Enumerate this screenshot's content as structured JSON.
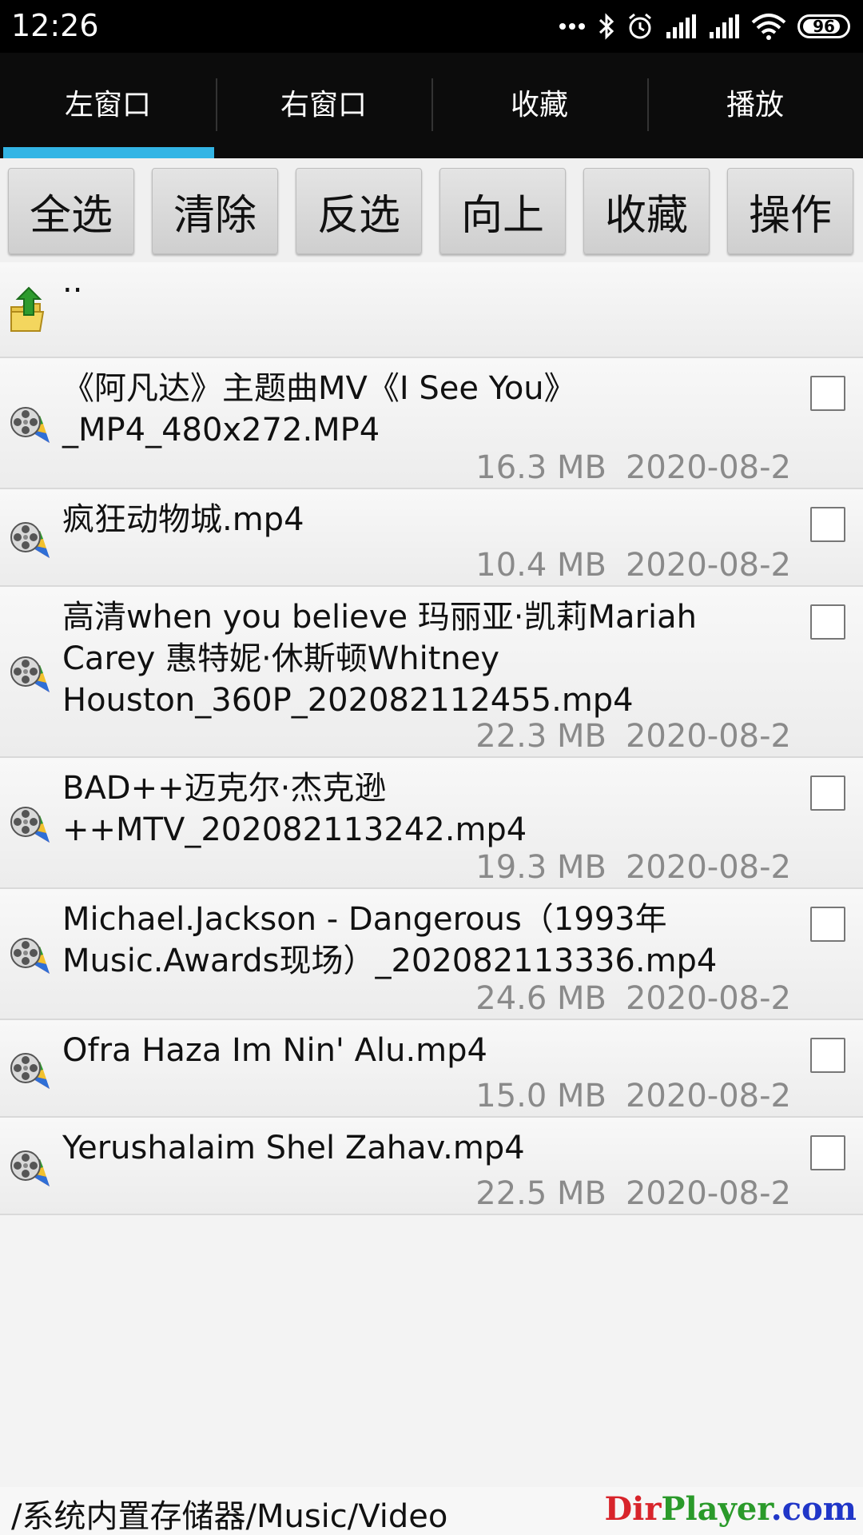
{
  "status_bar": {
    "time": "12:26",
    "icons": [
      "more-dots-icon",
      "bluetooth-icon",
      "alarm-icon",
      "signal-icon",
      "signal-icon",
      "wifi-icon"
    ],
    "battery": "96"
  },
  "tabs": [
    {
      "label": "左窗口",
      "active": true
    },
    {
      "label": "右窗口",
      "active": false
    },
    {
      "label": "收藏",
      "active": false
    },
    {
      "label": "播放",
      "active": false
    }
  ],
  "toolbar": {
    "select_all": "全选",
    "clear": "清除",
    "invert": "反选",
    "up": "向上",
    "favorite": "收藏",
    "operate": "操作"
  },
  "parent_dir": {
    "label": ".."
  },
  "files": [
    {
      "name": "《阿凡达》主题曲MV《I See You》_MP4_480x272.MP4",
      "size": "16.3 MB",
      "date": "2020-08-2"
    },
    {
      "name": "疯狂动物城.mp4",
      "size": "10.4 MB",
      "date": "2020-08-2"
    },
    {
      "name": "高清when you believe 玛丽亚·凯莉Mariah Carey 惠特妮·休斯顿Whitney Houston_360P_202082112455.mp4",
      "size": "22.3 MB",
      "date": "2020-08-2"
    },
    {
      "name": "BAD++迈克尔·杰克逊++MTV_202082113242.mp4",
      "size": "19.3 MB",
      "date": "2020-08-2"
    },
    {
      "name": "Michael.Jackson - Dangerous（1993年Music.Awards现场）_202082113336.mp4",
      "size": "24.6 MB",
      "date": "2020-08-2"
    },
    {
      "name": "Ofra Haza Im Nin' Alu.mp4",
      "size": "15.0 MB",
      "date": "2020-08-2"
    },
    {
      "name": "Yerushalaim Shel Zahav.mp4",
      "size": "22.5 MB",
      "date": "2020-08-2"
    }
  ],
  "footer": {
    "path": "/系统内置存储器/Music/Video",
    "brand_part1": "Dir",
    "brand_part2": "Player",
    "brand_part3": ".com"
  },
  "colors": {
    "tab_indicator": "#33b5e5",
    "brand_red": "#d8242b",
    "brand_green": "#2a9a2a",
    "brand_blue": "#2036c8"
  }
}
